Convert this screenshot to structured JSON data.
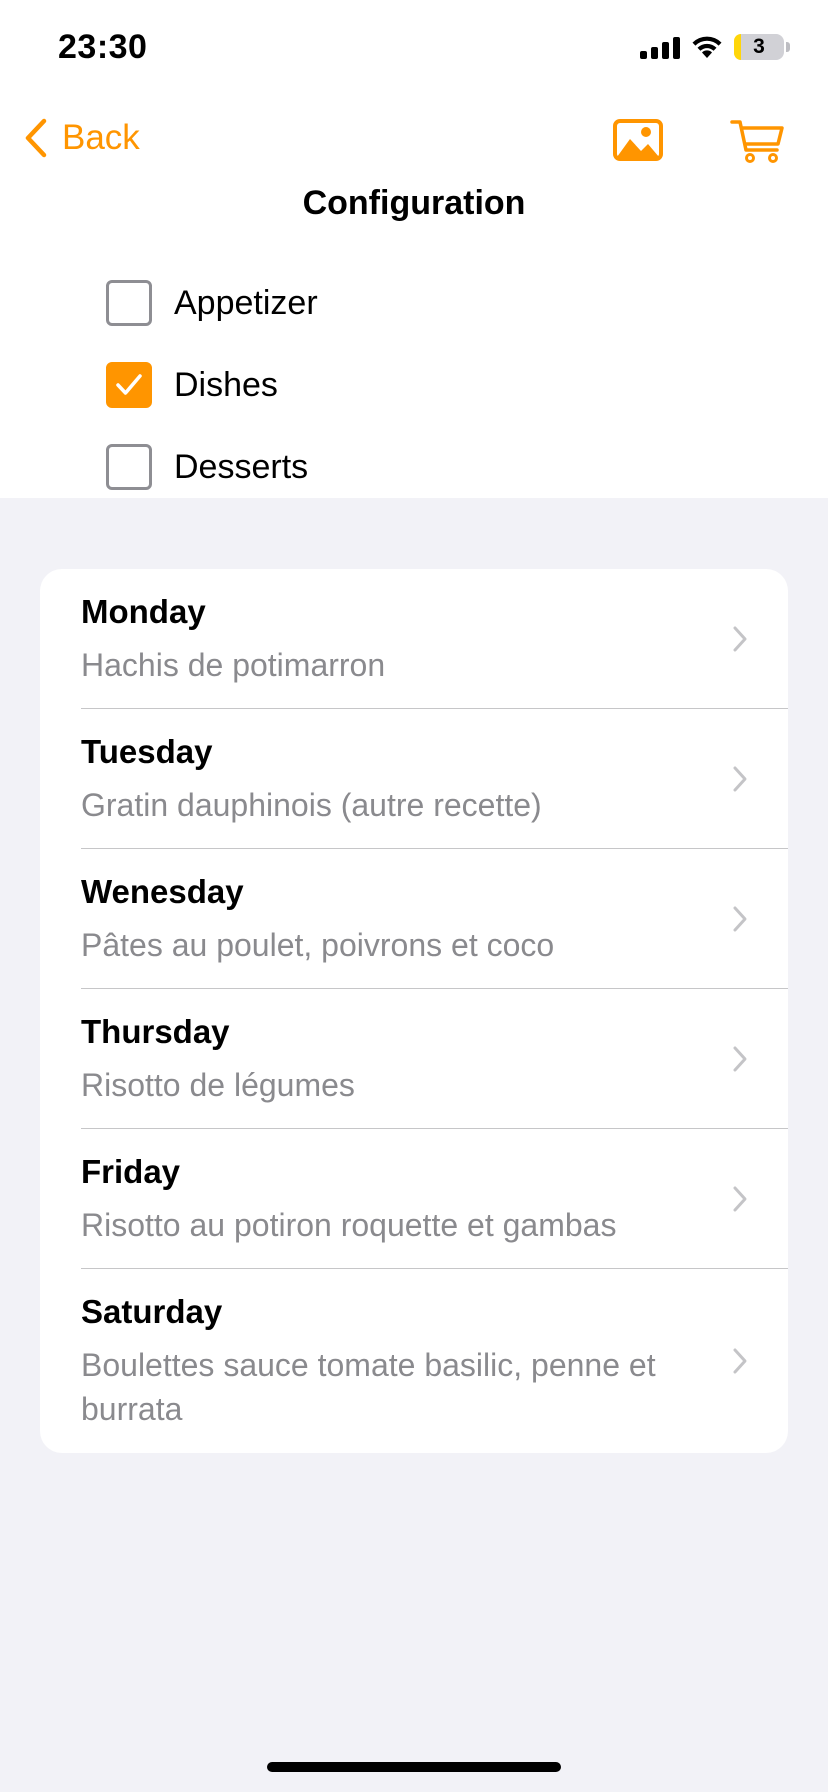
{
  "status_bar": {
    "time": "23:30",
    "battery_level": "3"
  },
  "nav": {
    "back_label": "Back",
    "title": "Configuration",
    "accent_color": "#ff9500"
  },
  "config": {
    "items": [
      {
        "label": "Appetizer",
        "checked": false
      },
      {
        "label": "Dishes",
        "checked": true
      },
      {
        "label": "Desserts",
        "checked": false
      }
    ]
  },
  "days": [
    {
      "day": "Monday",
      "dish": "Hachis de potimarron"
    },
    {
      "day": "Tuesday",
      "dish": "Gratin dauphinois (autre recette)"
    },
    {
      "day": "Wenesday",
      "dish": "Pâtes au poulet, poivrons et coco"
    },
    {
      "day": "Thursday",
      "dish": "Risotto de légumes"
    },
    {
      "day": "Friday",
      "dish": "Risotto au potiron roquette et gambas"
    },
    {
      "day": "Saturday",
      "dish": "Boulettes sauce tomate basilic, penne et burrata"
    }
  ],
  "icons": {
    "back": "chevron-left-icon",
    "photo": "photo-icon",
    "cart": "cart-icon",
    "row": "chevron-right-icon"
  }
}
